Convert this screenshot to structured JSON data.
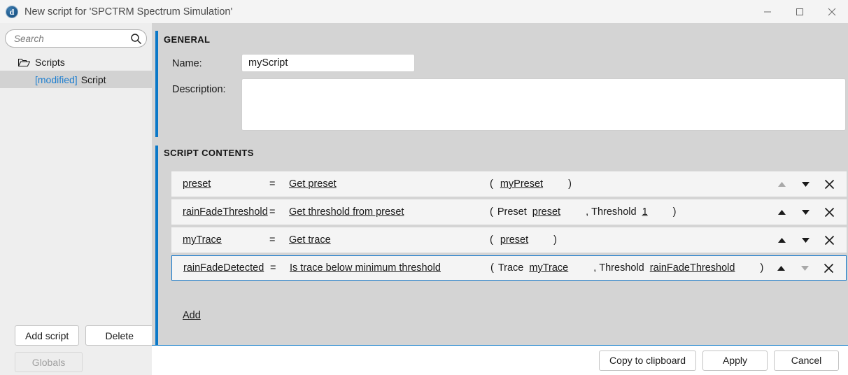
{
  "window": {
    "title": "New script for 'SPCTRM Spectrum Simulation'",
    "app_icon": "app-logo-icon",
    "controls": {
      "minimize": "minimize-icon",
      "maximize": "maximize-icon",
      "close": "close-icon"
    }
  },
  "colors": {
    "accent": "#0a78c8",
    "link": "#1f7fd0",
    "panel": "#d4d4d4",
    "sidebar": "#eeeeee",
    "row": "#f4f4f4",
    "selected_row_border": "#1177cc"
  },
  "sidebar": {
    "search": {
      "placeholder": "Search",
      "value": "",
      "icon": "search-icon"
    },
    "tree": [
      {
        "label": "Scripts",
        "icon": "folder-open-icon",
        "level": 0,
        "selected": false
      },
      {
        "prefix": "[modified]",
        "label": "Script",
        "level": 1,
        "selected": true
      }
    ],
    "buttons": {
      "add_script": "Add script",
      "delete": "Delete",
      "globals": "Globals"
    }
  },
  "general": {
    "section_title": "GENERAL",
    "name_label": "Name:",
    "name_value": "myScript",
    "description_label": "Description:",
    "description_value": "",
    "description_placeholder": ""
  },
  "script_contents": {
    "section_title": "SCRIPT CONTENTS",
    "add_label": "Add",
    "rows": [
      {
        "variable": "preset",
        "equals": "=",
        "function": "Get preset",
        "open_paren": "(",
        "close_paren": ")",
        "args": [
          {
            "label": "",
            "value": "myPreset"
          }
        ],
        "selected": false,
        "up_enabled": false,
        "down_enabled": true
      },
      {
        "variable": "rainFadeThreshold",
        "equals": "=",
        "function": "Get threshold from preset",
        "open_paren": "(",
        "close_paren": ")",
        "args": [
          {
            "label": "Preset",
            "value": "preset"
          },
          {
            "label": "Threshold",
            "value": "1",
            "separator": ","
          }
        ],
        "selected": false,
        "up_enabled": true,
        "down_enabled": true
      },
      {
        "variable": "myTrace",
        "equals": "=",
        "function": "Get trace",
        "open_paren": "(",
        "close_paren": ")",
        "args": [
          {
            "label": "",
            "value": "preset"
          }
        ],
        "selected": false,
        "up_enabled": true,
        "down_enabled": true
      },
      {
        "variable": "rainFadeDetected",
        "equals": "=",
        "function": "Is trace below minimum threshold",
        "open_paren": "(",
        "close_paren": ")",
        "args": [
          {
            "label": "Trace",
            "value": "myTrace"
          },
          {
            "label": "Threshold",
            "value": "rainFadeThreshold",
            "separator": ","
          }
        ],
        "selected": true,
        "up_enabled": true,
        "down_enabled": false
      }
    ],
    "row_icons": {
      "move_up": "arrow-up-icon",
      "move_down": "arrow-down-icon",
      "remove": "close-icon"
    }
  },
  "footer": {
    "copy": "Copy to clipboard",
    "apply": "Apply",
    "cancel": "Cancel"
  }
}
